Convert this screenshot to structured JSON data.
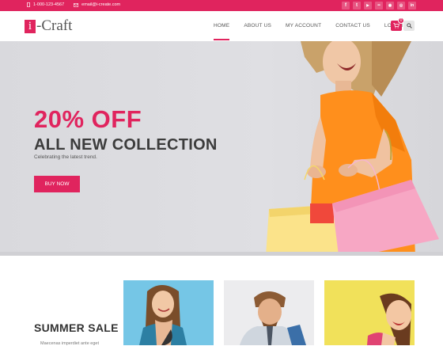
{
  "topbar": {
    "phone": "1-000-123-4567",
    "email": "email@i-create.com",
    "socials": [
      "facebook-icon",
      "twitter-icon",
      "youtube-icon",
      "flickr-icon",
      "rss-icon",
      "instagram-icon",
      "linkedin-icon"
    ],
    "social_glyphs": [
      "f",
      "t",
      "▶",
      "••",
      "◉",
      "◎",
      "in"
    ]
  },
  "header": {
    "logo_mark": "i",
    "logo_text": "-Craft",
    "nav": [
      "HOME",
      "ABOUT US",
      "MY ACCOUNT",
      "CONTACT US",
      "LOG IN"
    ],
    "cart_count": "0"
  },
  "hero": {
    "discount": "20% OFF",
    "headline": "ALL NEW COLLECTION",
    "tagline": "Celebrating the latest trend.",
    "button": "BUY NOW"
  },
  "sale": {
    "title": "SUMMER SALE",
    "desc": "Maecenas imperdiet ante eget"
  },
  "colors": {
    "accent": "#e0245e"
  }
}
